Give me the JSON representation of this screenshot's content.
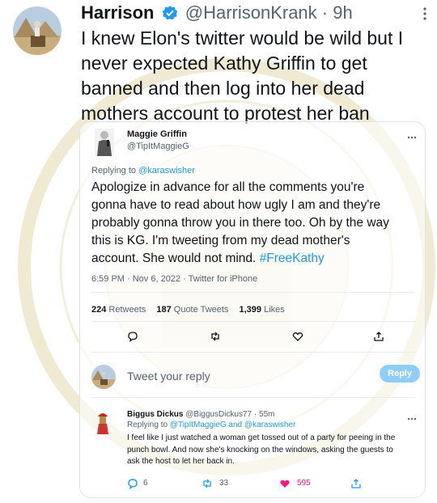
{
  "tweet": {
    "author_name": "Harrison",
    "author_handle": "@HarrisonKrank",
    "separator": "·",
    "time": "9h",
    "lines": [
      "I knew Elon's twitter would be wild but I",
      "never expected Kathy Griffin to get",
      "banned and then log into her dead",
      "mothers account to protest her ban"
    ]
  },
  "embedded": {
    "author_name": "Maggie Griffin",
    "author_handle": "@TipItMaggieG",
    "replying_prefix": "Replying to ",
    "replying_to": "@karaswisher",
    "body_lines": [
      "Apologize in advance for all the comments you're",
      "gonna have to read about how ugly I am and they're",
      "probably gonna throw you in there too. Oh by the way",
      "this is KG. I'm tweeting from my dead mother's"
    ],
    "body_last": "account. She would not mind. ",
    "hashtag": "#FreeKathy",
    "meta": "6:59 PM · Nov 6, 2022 · Twitter for iPhone",
    "stats": {
      "retweets_count": "224",
      "retweets_label": "Retweets",
      "quotes_count": "187",
      "quotes_label": "Quote Tweets",
      "likes_count": "1,399",
      "likes_label": "Likes"
    }
  },
  "reply_box": {
    "placeholder": "Tweet your reply",
    "button_label": "Reply"
  },
  "reply": {
    "author_name": "Biggus Dickus",
    "author_handle": "@BiggusDickus77",
    "separator": "·",
    "time": "55m",
    "replying_prefix": "Replying to ",
    "replying_to_1": "@TipItMaggieG",
    "replying_and": " and ",
    "replying_to_2": "@karaswisher",
    "text_lines": [
      "I feel like I just watched a woman get tossed out of a party for peeing in the",
      "punch bowl.  And now she's knocking on the windows, asking the guests to",
      "ask the host to let her back in."
    ],
    "reply_count": "6",
    "retweet_count": "33",
    "like_count": "595"
  },
  "colors": {
    "accent": "#1d9bf0",
    "like": "#f91880",
    "muted": "#536471"
  }
}
